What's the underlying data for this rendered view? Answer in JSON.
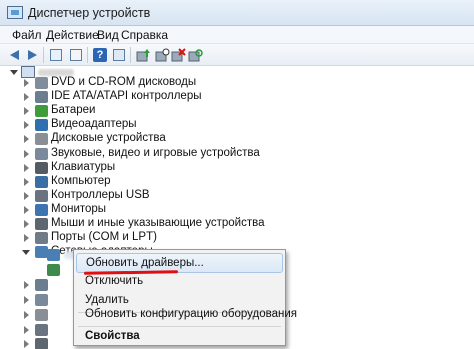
{
  "window": {
    "title": "Диспетчер устройств"
  },
  "menu": {
    "items": [
      "Файл",
      "Действие",
      "Вид",
      "Справка"
    ]
  },
  "toolbar": {
    "buttons": [
      "back-arrow-icon",
      "forward-arrow-icon",
      "console-tree-icon",
      "properties-icon",
      "help-icon",
      "console-icon",
      "update-driver-icon",
      "uninstall-icon",
      "scan-hardware-icon"
    ]
  },
  "tree": {
    "categories": [
      {
        "label": "DVD и CD-ROM дисководы",
        "icon": "dvd-drive-icon",
        "color": "#7f8c99"
      },
      {
        "label": "IDE ATA/ATAPI контроллеры",
        "icon": "ide-controller-icon",
        "color": "#6b7d8f"
      },
      {
        "label": "Батареи",
        "icon": "battery-icon",
        "color": "#3e9c3a"
      },
      {
        "label": "Видеоадаптеры",
        "icon": "display-adapter-icon",
        "color": "#2f6fae"
      },
      {
        "label": "Дисковые устройства",
        "icon": "disk-drive-icon",
        "color": "#8a8f96"
      },
      {
        "label": "Звуковые, видео и игровые устройства",
        "icon": "sound-icon",
        "color": "#7a8a9a"
      },
      {
        "label": "Клавиатуры",
        "icon": "keyboard-icon",
        "color": "#555b63"
      },
      {
        "label": "Компьютер",
        "icon": "computer-icon",
        "color": "#3b6ea3"
      },
      {
        "label": "Контроллеры USB",
        "icon": "usb-icon",
        "color": "#6a7480"
      },
      {
        "label": "Мониторы",
        "icon": "monitor-icon",
        "color": "#3e75b0"
      },
      {
        "label": "Мыши и иные указывающие устройства",
        "icon": "mouse-icon",
        "color": "#5e6670"
      },
      {
        "label": "Порты (COM и LPT)",
        "icon": "port-icon",
        "color": "#6f7b87"
      },
      {
        "label": "Сетевые адаптеры",
        "icon": "network-adapter-icon",
        "color": "#4a7fb4"
      }
    ]
  },
  "context_menu": {
    "items": [
      {
        "label": "Обновить драйверы...",
        "bold": false,
        "highlighted": true
      },
      {
        "label": "Отключить",
        "bold": false,
        "highlighted": false
      },
      {
        "label": "Удалить",
        "bold": false,
        "highlighted": false
      },
      {
        "label": "Обновить конфигурацию оборудования",
        "bold": false,
        "highlighted": false
      },
      {
        "label": "Свойства",
        "bold": true,
        "highlighted": false
      }
    ],
    "annotation_color": "#e01010"
  }
}
